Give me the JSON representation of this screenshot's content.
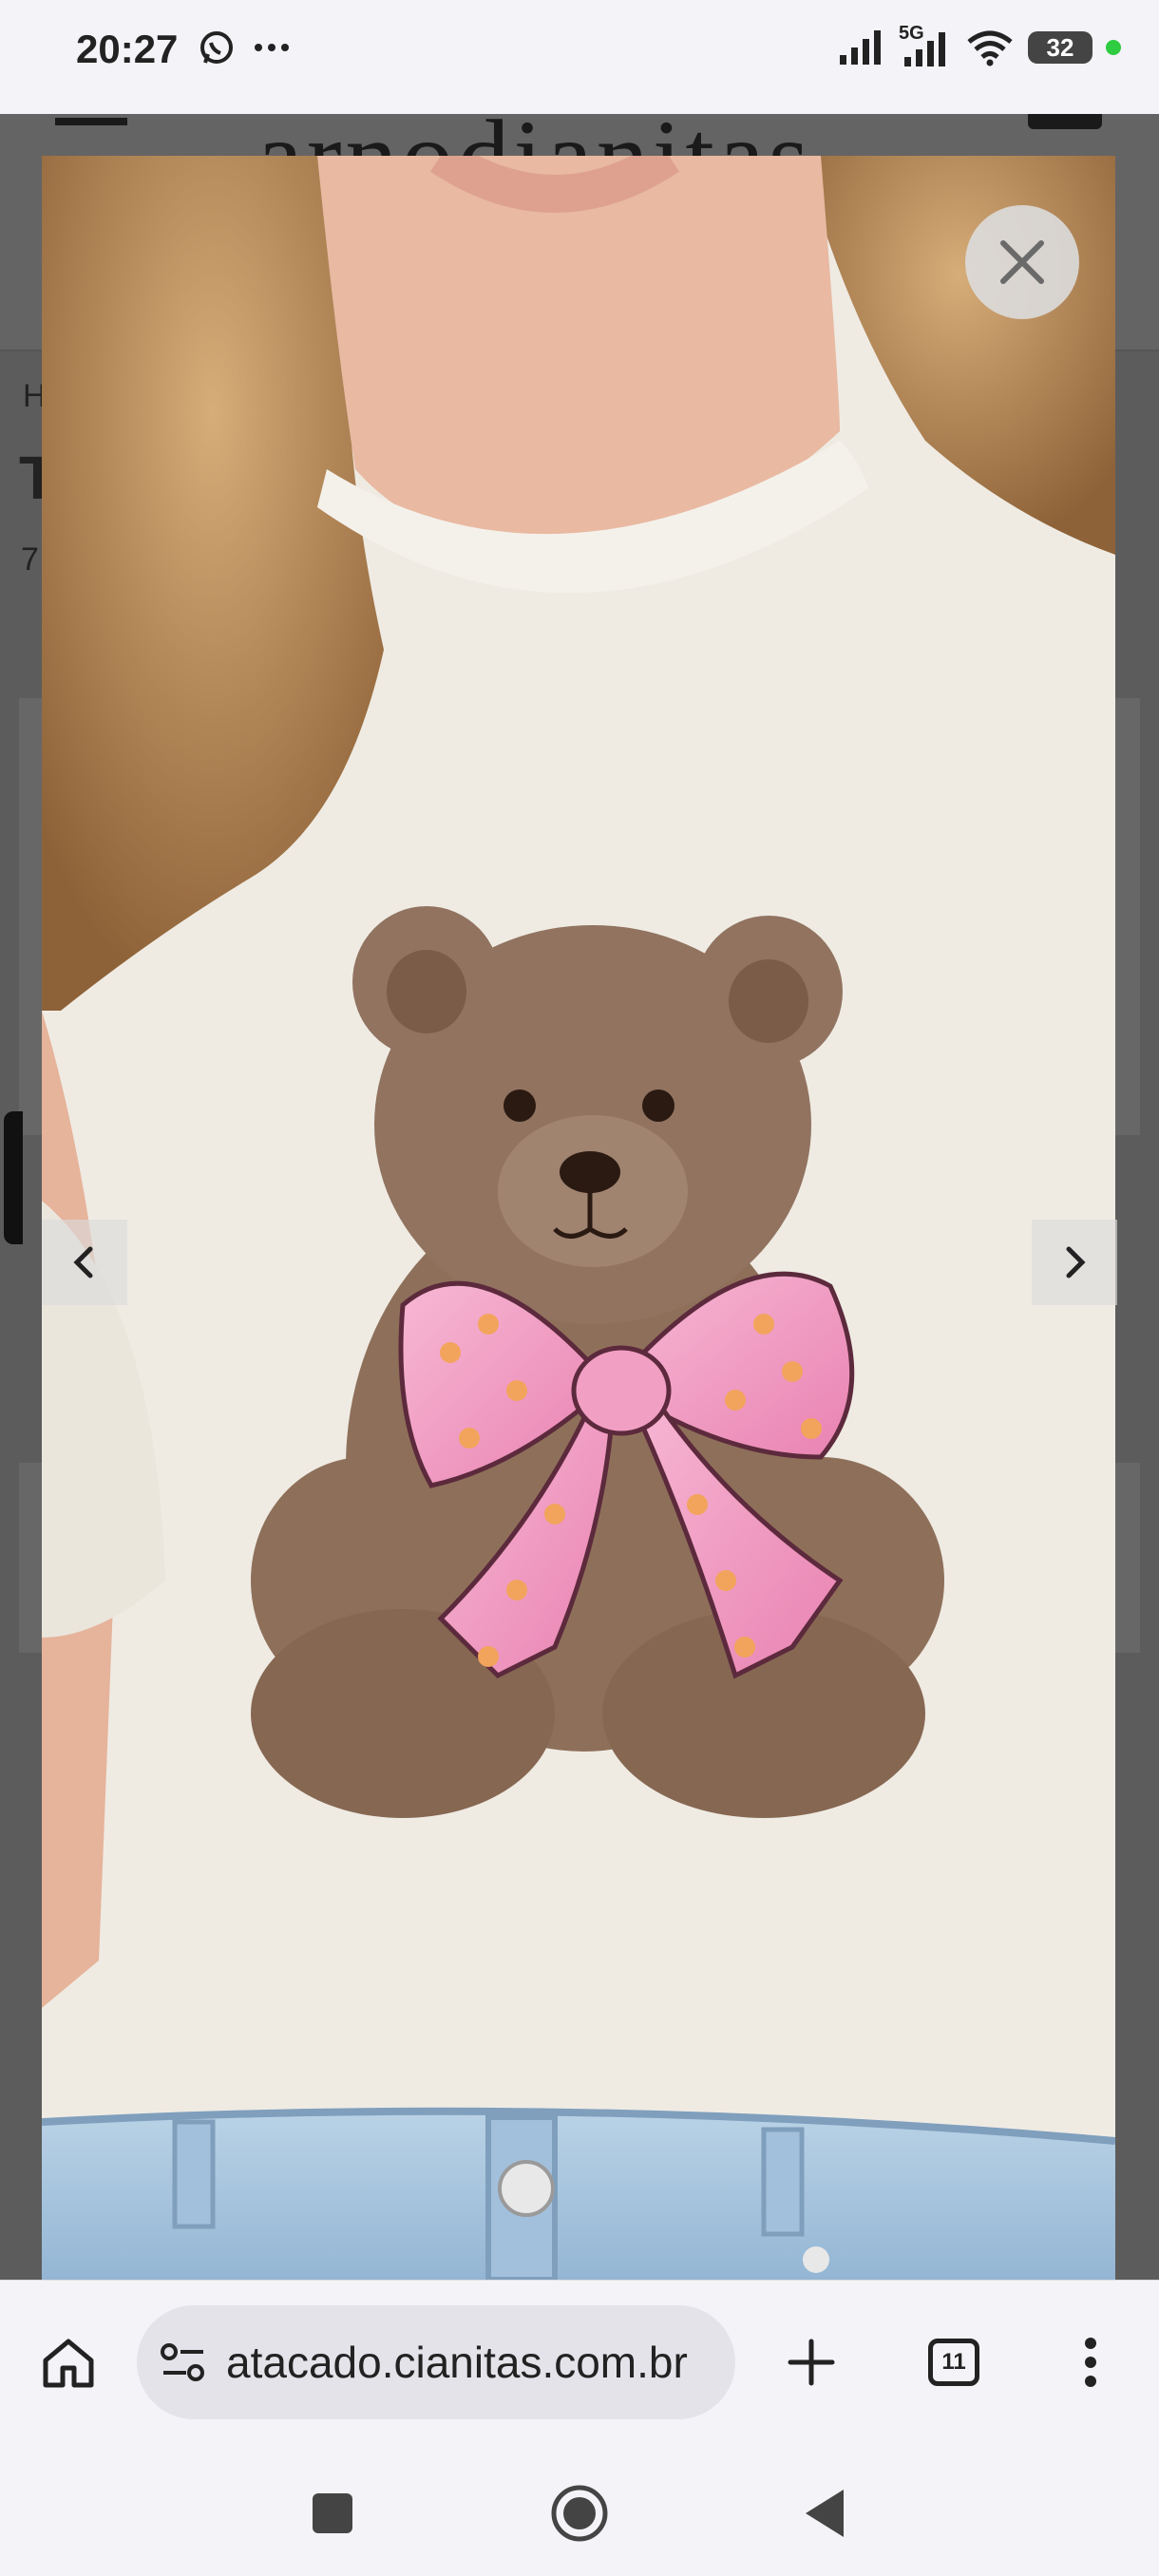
{
  "status_bar": {
    "time": "20:27",
    "network_label": "5G",
    "battery": "32",
    "icons": [
      "whatsapp-icon",
      "more-dots-icon",
      "signal-icon",
      "signal-5g-icon",
      "wifi-icon",
      "battery-icon"
    ]
  },
  "background_page": {
    "logo_text": "arnodianitas",
    "breadcrumb_initial": "H",
    "title_initial": "T",
    "subtitle_initial": "7"
  },
  "lightbox": {
    "image_alt": "Camiseta off-white com estampa de urso de pelúcia com laço rosa",
    "colors": {
      "shirt": "#efebe3",
      "bear": "#8c6e58",
      "bow": "#f29fc4",
      "jeans": "#a9c6de",
      "hair": "#b58a5c",
      "skin": "#e9b9a2"
    },
    "icons": [
      "close-icon",
      "chevron-left-icon",
      "chevron-right-icon"
    ]
  },
  "browser": {
    "url": "atacado.cianitas.com.br",
    "tab_count": "11",
    "icons": [
      "home-icon",
      "site-settings-icon",
      "new-tab-plus-icon",
      "tabs-icon",
      "menu-dots-icon"
    ]
  },
  "system_nav": {
    "icons": [
      "recents-square-icon",
      "home-circle-icon",
      "back-triangle-icon"
    ]
  }
}
